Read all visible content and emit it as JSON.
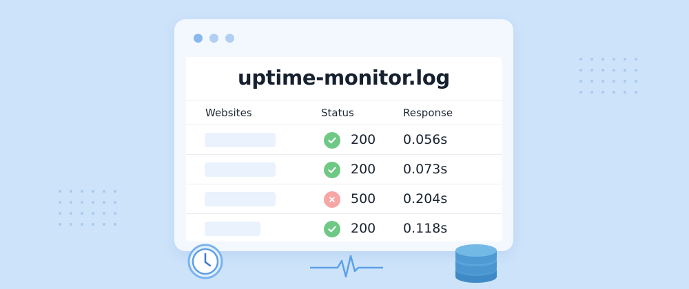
{
  "title": "uptime-monitor.log",
  "table": {
    "headers": {
      "websites": "Websites",
      "status": "Status",
      "response": "Response"
    },
    "rows": [
      {
        "status": "ok",
        "code": "200",
        "response": "0.056s"
      },
      {
        "status": "ok",
        "code": "200",
        "response": "0.073s"
      },
      {
        "status": "error",
        "code": "500",
        "response": "0.204s"
      },
      {
        "status": "ok",
        "code": "200",
        "response": "0.118s"
      }
    ]
  },
  "icons": {
    "window_controls": [
      "window-dot-icon",
      "window-dot-icon",
      "window-dot-icon"
    ],
    "status_ok": "check-circle-icon",
    "status_error": "x-circle-icon",
    "decor": [
      "clock-icon",
      "heartbeat-icon",
      "database-icon"
    ]
  },
  "colors": {
    "background": "#cde3fa",
    "ok": "#6fc985",
    "error": "#f7a5a5",
    "accent": "#5b9fe8"
  }
}
